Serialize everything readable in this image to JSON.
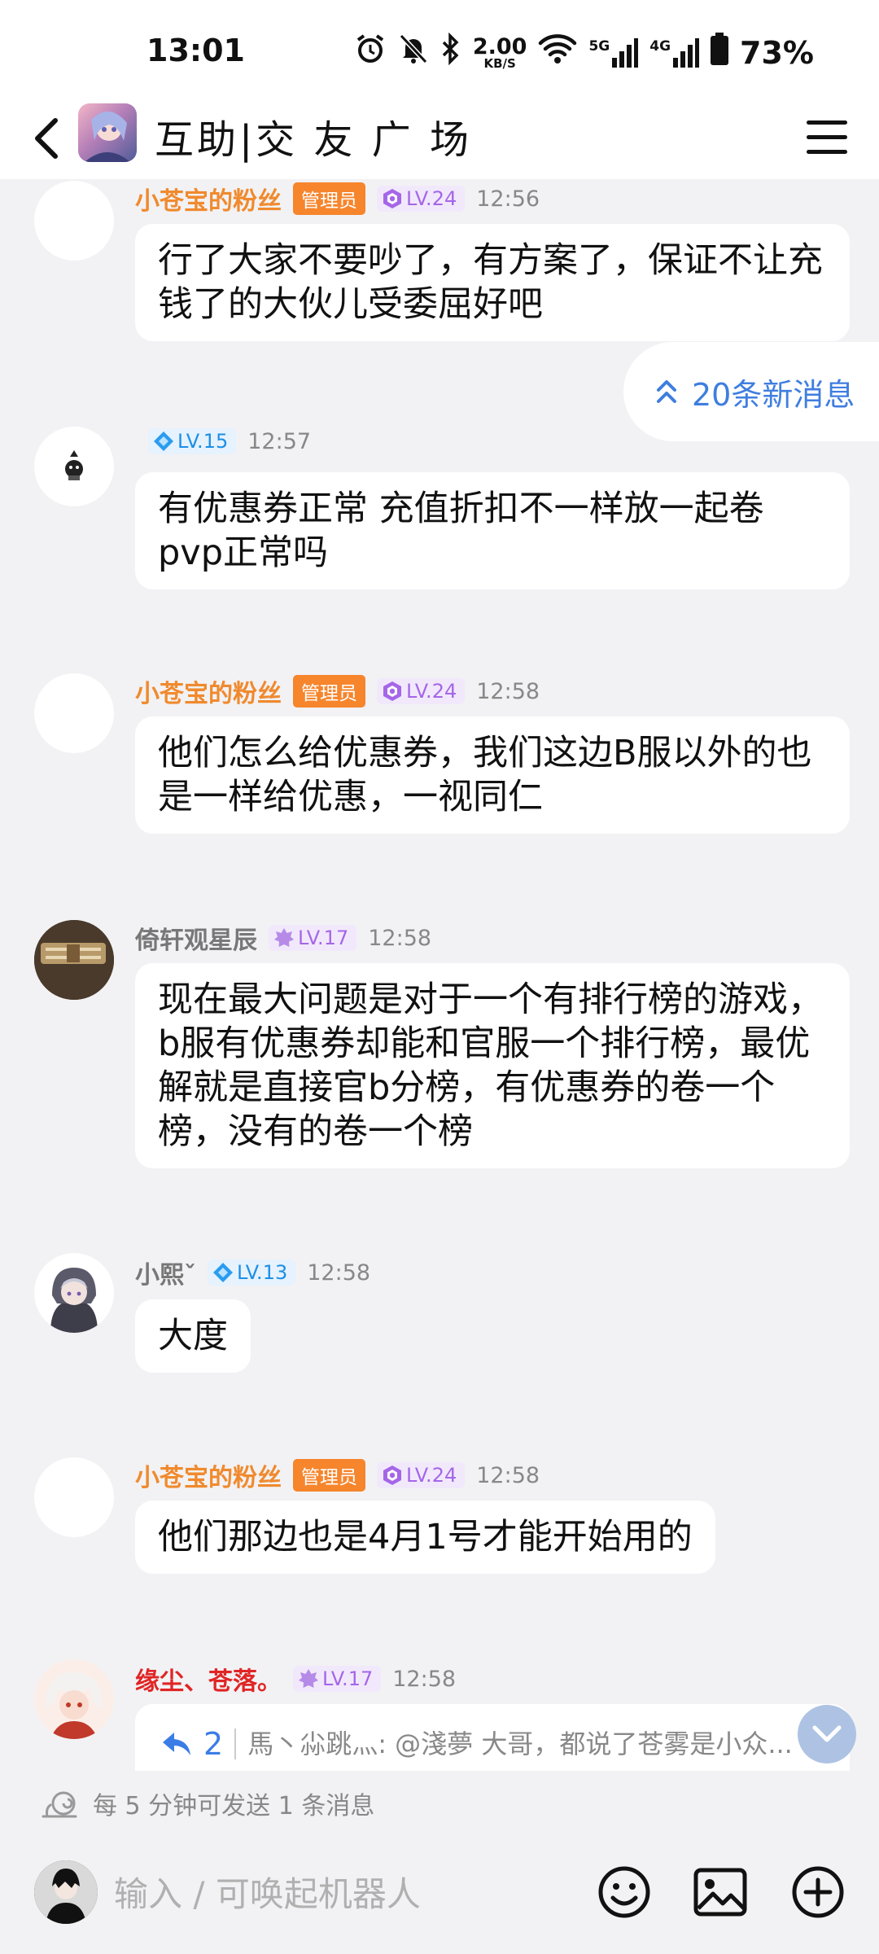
{
  "status_bar": {
    "time": "13:01",
    "net_speed": "2.00",
    "net_unit": "KB/S",
    "signal1": "5G",
    "signal2": "4G",
    "battery": "73%"
  },
  "header": {
    "title": "互助|交 友 广 场"
  },
  "new_messages": "20条新消息",
  "messages": [
    {
      "name": "小苍宝的粉丝",
      "admin": "管理员",
      "level": "LV.24",
      "time": "12:56",
      "text": "行了大家不要吵了，有方案了，保证不让充钱了的大伙儿受委屈好吧"
    },
    {
      "name": "",
      "level": "LV.15",
      "time": "12:57",
      "text": "有优惠券正常 充值折扣不一样放一起卷pvp正常吗"
    },
    {
      "name": "小苍宝的粉丝",
      "admin": "管理员",
      "level": "LV.24",
      "time": "12:58",
      "text": "他们怎么给优惠券，我们这边B服以外的也是一样给优惠，一视同仁"
    },
    {
      "name": "倚轩观星辰",
      "level": "LV.17",
      "time": "12:58",
      "text": "现在最大问题是对于一个有排行榜的游戏，b服有优惠券却能和官服一个排行榜，最优解就是直接官b分榜，有优惠券的卷一个榜，没有的卷一个榜"
    },
    {
      "name": "小熙ˇ",
      "level": "LV.13",
      "time": "12:58",
      "text": "大度"
    },
    {
      "name": "小苍宝的粉丝",
      "admin": "管理员",
      "level": "LV.24",
      "time": "12:58",
      "text": "他们那边也是4月1号才能开始用的"
    },
    {
      "name": "缘尘、苍落。",
      "level": "LV.17",
      "time": "12:58",
      "reply_count": "2",
      "reply_text": "馬丶尛跳灬: @淺夢 大哥，都说了苍雾是小众..."
    }
  ],
  "rate_limit": "每 5 分钟可发送 1 条消息",
  "input": {
    "placeholder": "输入 / 可唤起机器人"
  }
}
